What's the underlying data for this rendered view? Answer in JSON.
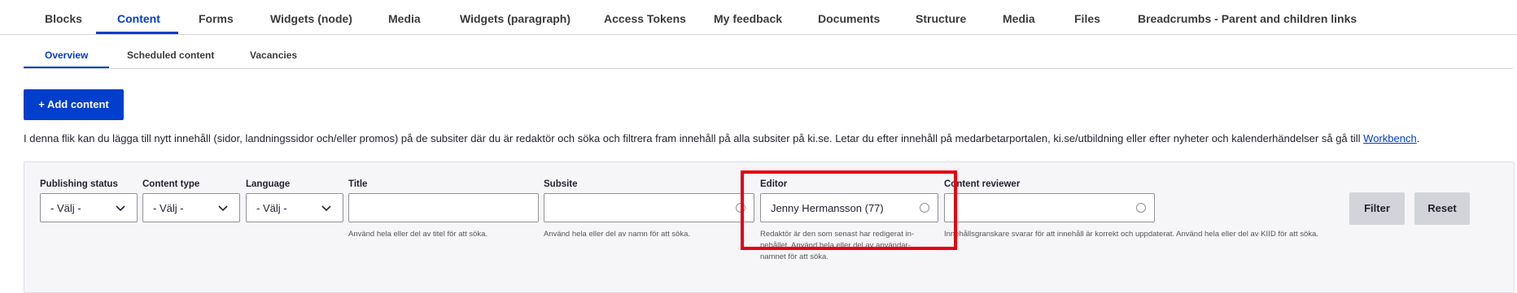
{
  "primary_tabs": [
    {
      "label": "Blocks"
    },
    {
      "label": "Content"
    },
    {
      "label": "Forms"
    },
    {
      "label": "Widgets (node)"
    },
    {
      "label": "Media"
    },
    {
      "label": "Widgets (paragraph)"
    },
    {
      "label": "Access Tokens"
    },
    {
      "label": "My feedback"
    },
    {
      "label": "Documents"
    },
    {
      "label": "Structure"
    },
    {
      "label": "Media"
    },
    {
      "label": "Files"
    },
    {
      "label": "Breadcrumbs - Parent and children links"
    }
  ],
  "active_primary_tab": "Content",
  "secondary_tabs": [
    {
      "label": "Overview"
    },
    {
      "label": "Scheduled content"
    },
    {
      "label": "Vacancies"
    }
  ],
  "active_secondary_tab": "Overview",
  "add_button": "+ Add content",
  "intro": {
    "text": "I denna flik kan du lägga till nytt innehåll (sidor, landningssidor och/eller promos) på de subsiter där du är redaktör och söka och filtrera fram innehåll på alla subsiter på ki.se. Letar du efter innehåll på medarbetarportalen, ki.se/utbildning eller efter nyheter och kalenderhändelser så gå till ",
    "link": "Workbench",
    "end": "."
  },
  "filters": {
    "publishing_status": {
      "label": "Publishing status",
      "value": "- Välj -"
    },
    "content_type": {
      "label": "Content type",
      "value": "- Välj -"
    },
    "language": {
      "label": "Language",
      "value": "- Välj -"
    },
    "title": {
      "label": "Title",
      "value": "",
      "description": "Använd hela eller del av titel för att söka."
    },
    "subsite": {
      "label": "Subsite",
      "value": "",
      "description": "Använd hela eller del av namn för att söka."
    },
    "editor": {
      "label": "Editor",
      "value": "Jenny Hermansson (77)",
      "description_line1": "Redaktör är den som senast har redigerat in-",
      "description_line2": "nehållet. Använd hela eller del av användar-",
      "description_line3": "namnet för att söka."
    },
    "content_reviewer": {
      "label": "Content reviewer",
      "value": "",
      "description": "Innehållsgranskare svarar för att innehåll är korrekt och uppdaterat. Använd hela eller del av KIID för att söka."
    }
  },
  "buttons": {
    "filter": "Filter",
    "reset": "Reset"
  },
  "colors": {
    "accent": "#003ecc",
    "highlight": "#e60012"
  }
}
